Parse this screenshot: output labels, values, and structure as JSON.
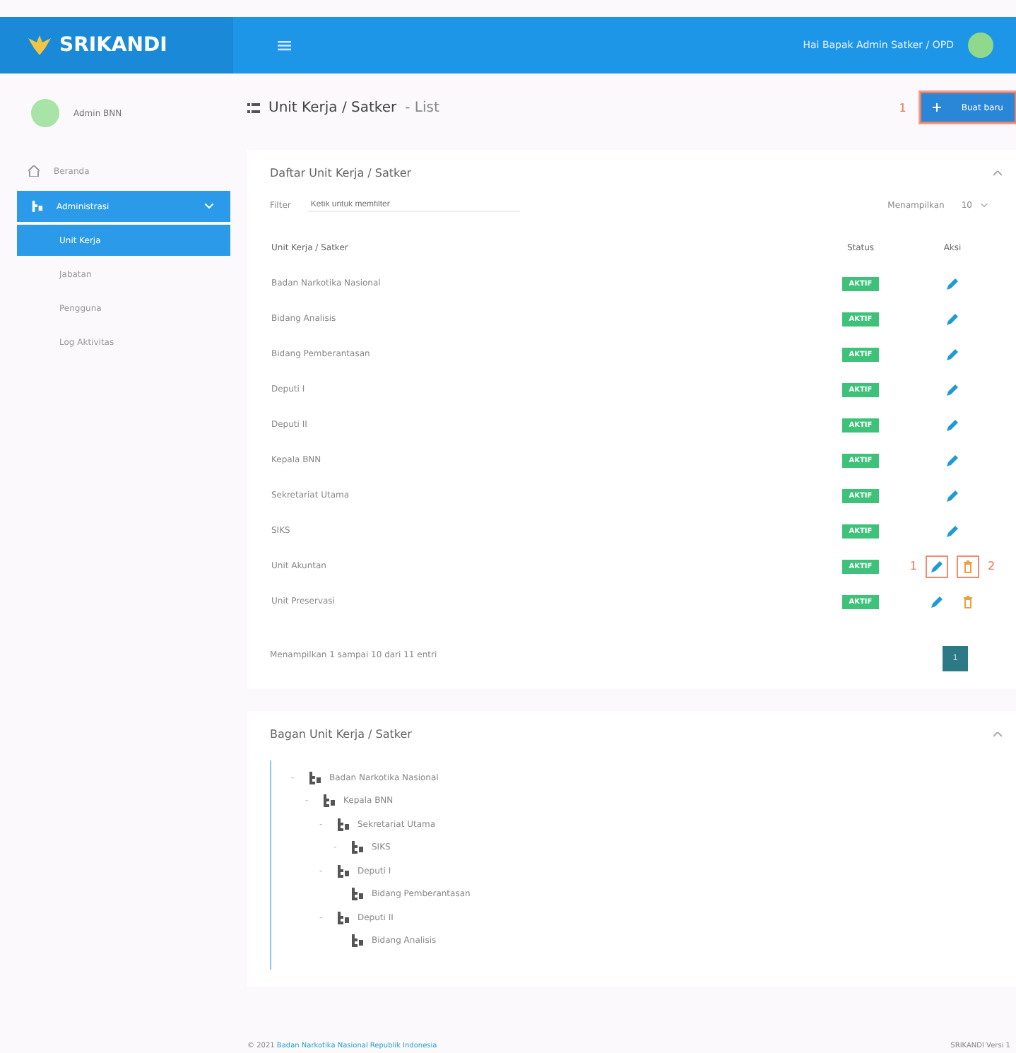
{
  "brand": {
    "name": "SRIKANDI"
  },
  "topbar": {
    "menu_glyph": "≡",
    "greeting": "Hai Bapak Admin Satker / OPD"
  },
  "sidebar": {
    "user": {
      "name": "Admin BNN"
    },
    "items": [
      {
        "label": "Beranda",
        "kind": "top",
        "selected": false
      },
      {
        "label": "Administrasi",
        "kind": "group",
        "selected": true,
        "expanded": true
      },
      {
        "label": "Unit Kerja",
        "kind": "sub",
        "selected": true
      },
      {
        "label": "Jabatan",
        "kind": "sub",
        "selected": false
      },
      {
        "label": "Pengguna",
        "kind": "sub",
        "selected": false
      },
      {
        "label": "Log Aktivitas",
        "kind": "sub",
        "selected": false
      }
    ]
  },
  "page": {
    "title": "Unit Kerja / Satker",
    "subtitle": "- List",
    "new_button": {
      "label": "Buat baru",
      "marker": "1"
    }
  },
  "list_card": {
    "title": "Daftar Unit Kerja / Satker",
    "filter_label": "Filter",
    "filter_placeholder": "Ketik untuk memfilter",
    "show_label": "Menampilkan",
    "page_size": "10",
    "columns": [
      "Unit Kerja / Satker",
      "Status",
      "Aksi"
    ],
    "rows": [
      {
        "name": "Badan Narkotika Nasional",
        "status": "AKTIF",
        "can_delete": false,
        "markers": []
      },
      {
        "name": "Bidang Analisis",
        "status": "AKTIF",
        "can_delete": false,
        "markers": []
      },
      {
        "name": "Bidang Pemberantasan",
        "status": "AKTIF",
        "can_delete": false,
        "markers": []
      },
      {
        "name": "Deputi I",
        "status": "AKTIF",
        "can_delete": false,
        "markers": []
      },
      {
        "name": "Deputi II",
        "status": "AKTIF",
        "can_delete": false,
        "markers": []
      },
      {
        "name": "Kepala BNN",
        "status": "AKTIF",
        "can_delete": false,
        "markers": []
      },
      {
        "name": "Sekretariat Utama",
        "status": "AKTIF",
        "can_delete": false,
        "markers": []
      },
      {
        "name": "SIKS",
        "status": "AKTIF",
        "can_delete": false,
        "markers": []
      },
      {
        "name": "Unit Akuntan",
        "status": "AKTIF",
        "can_delete": true,
        "markers": [
          "1",
          "2"
        ]
      },
      {
        "name": "Unit Preservasi",
        "status": "AKTIF",
        "can_delete": true,
        "markers": []
      }
    ],
    "info": "Menampilkan 1 sampai 10 dari 11 entri",
    "pages": [
      {
        "label": "1",
        "selected": true
      }
    ]
  },
  "tree_card": {
    "title": "Bagan Unit Kerja / Satker",
    "tree": [
      {
        "label": "Badan Narkotika Nasional",
        "toggle": "-",
        "children": [
          {
            "label": "Kepala BNN",
            "toggle": "-",
            "children": [
              {
                "label": "Sekretariat Utama",
                "toggle": "-",
                "children": [
                  {
                    "label": "SIKS",
                    "toggle": "-"
                  }
                ]
              },
              {
                "label": "Deputi I",
                "toggle": "-",
                "children": [
                  {
                    "label": "Bidang Pemberantasan"
                  }
                ]
              },
              {
                "label": "Deputi II",
                "toggle": "-",
                "children": [
                  {
                    "label": "Bidang Analisis"
                  }
                ]
              }
            ]
          }
        ]
      }
    ]
  },
  "footer": {
    "copyright": "© 2021",
    "org_link": "Badan Narkotika Nasional Republik Indonesia",
    "version": "SRIKANDI Versi 1"
  }
}
